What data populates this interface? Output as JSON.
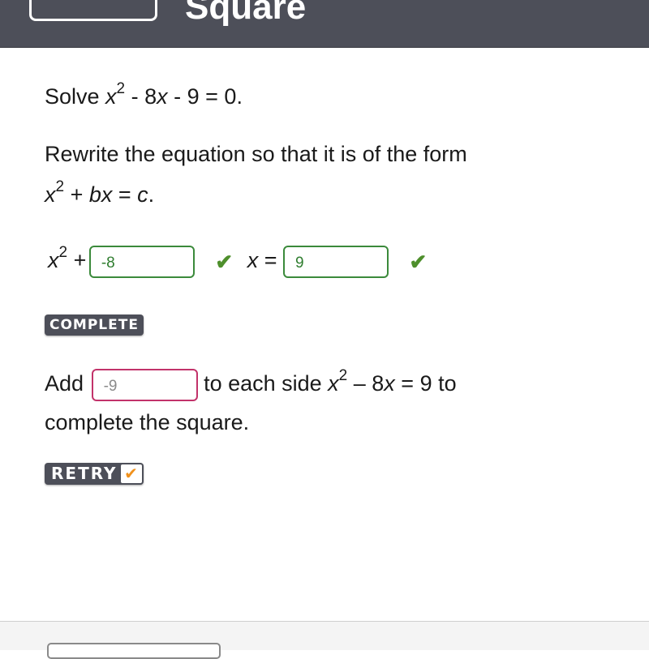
{
  "header": {
    "title": "Square"
  },
  "problem": {
    "solve_prefix": "Solve ",
    "solve_var": "x",
    "solve_exp": "2",
    "solve_rest_1": " - 8",
    "solve_var2": "x",
    "solve_rest_2": " - 9 = 0."
  },
  "step1": {
    "instruction": "Rewrite the equation so that it is of the form",
    "form_var": "x",
    "form_exp": "2",
    "form_plus": " + ",
    "form_b": "bx",
    "form_eq": " = ",
    "form_c": "c",
    "form_end": ".",
    "eq_var": "x",
    "eq_exp": "2",
    "eq_plus": " + ",
    "b_input_value": "-8",
    "b_status": "correct",
    "x_label": "x",
    "x_eq": " = ",
    "c_input_value": "9",
    "c_status": "correct",
    "check_glyph": "✔",
    "badge_label": "COMPLETE"
  },
  "step2": {
    "add_label": "Add",
    "input_value": "-9",
    "input_status": "incorrect",
    "text_1": " to each side ",
    "eq_var": "x",
    "eq_exp": "2",
    "eq_rest_1": " – 8",
    "eq_var2": "x",
    "eq_rest_2": " = 9 to",
    "line2": "complete the square.",
    "retry_label": "RETRY",
    "retry_check_glyph": "✔"
  },
  "colors": {
    "header_bg": "#4d4f59",
    "correct_green": "#3b8a3b",
    "incorrect_pink": "#c2336a",
    "retry_orange": "#f0911c"
  }
}
